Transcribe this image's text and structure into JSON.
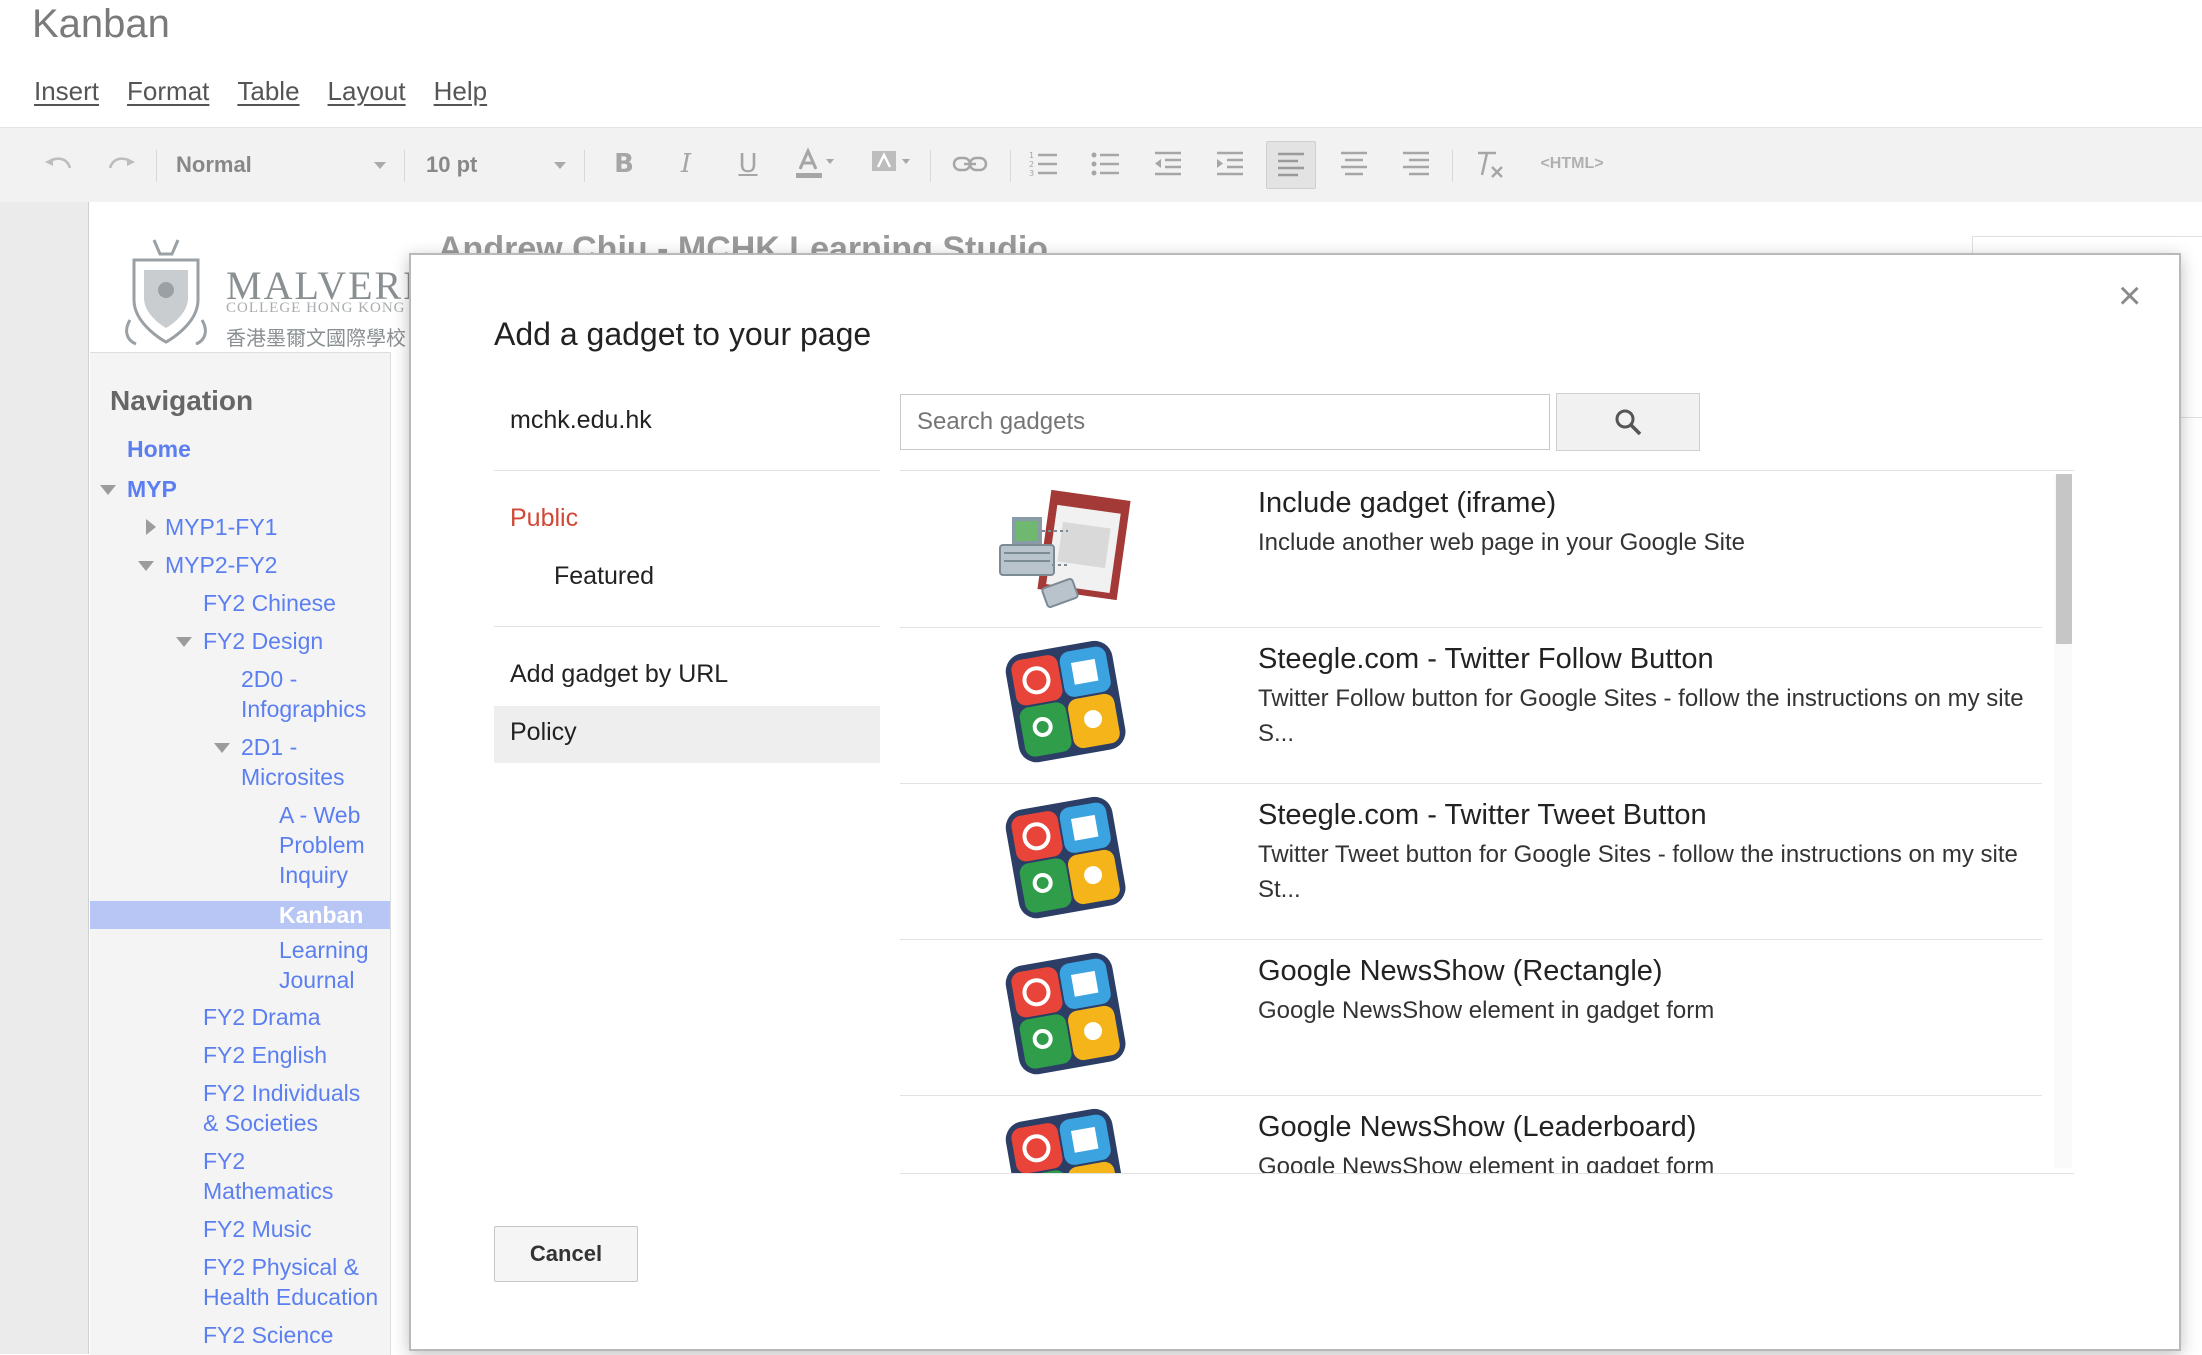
{
  "app": {
    "doc_title": "Kanban"
  },
  "menu": [
    "Insert",
    "Format",
    "Table",
    "Layout",
    "Help"
  ],
  "toolbar": {
    "style_select": "Normal",
    "size_select": "10 pt",
    "html_label": "<HTML>",
    "icons": [
      "undo-icon",
      "redo-icon",
      "bold-icon",
      "italic-icon",
      "underline-icon",
      "text-color-icon",
      "highlight-color-icon",
      "link-icon",
      "numbered-list-icon",
      "bulleted-list-icon",
      "decrease-indent-icon",
      "increase-indent-icon",
      "align-left-icon",
      "align-center-icon",
      "align-right-icon",
      "clear-formatting-icon"
    ]
  },
  "page": {
    "heading": "Andrew Chiu - MCHK Learning Studio",
    "logo": {
      "name": "MALVERN",
      "subtitle": "COLLEGE HONG KONG",
      "chinese": "香港墨爾文國際學校"
    }
  },
  "navigation": {
    "title": "Navigation",
    "items": [
      {
        "label": "Home"
      },
      {
        "label": "MYP"
      },
      {
        "label": "MYP1-FY1"
      },
      {
        "label": "MYP2-FY2"
      },
      {
        "label": "FY2 Chinese"
      },
      {
        "label": "FY2 Design"
      },
      {
        "label": "2D0 -",
        "label2": "Infographics"
      },
      {
        "label": "2D1 -",
        "label2": "Microsites"
      },
      {
        "label": "A - Web",
        "label2": "Problem",
        "label3": "Inquiry"
      },
      {
        "label": "Kanban"
      },
      {
        "label": "Learning",
        "label2": "Journal"
      },
      {
        "label": "FY2 Drama"
      },
      {
        "label": "FY2 English"
      },
      {
        "label": "FY2 Individuals",
        "label2": "& Societies"
      },
      {
        "label": "FY2",
        "label2": "Mathematics"
      },
      {
        "label": "FY2 Music"
      },
      {
        "label": "FY2 Physical &",
        "label2": "Health Education"
      },
      {
        "label": "FY2 Science"
      }
    ]
  },
  "dialog": {
    "title": "Add a gadget to your page",
    "close_glyph": "×",
    "left_menu": {
      "domain": "mchk.edu.hk",
      "public": "Public",
      "featured": "Featured",
      "by_url": "Add gadget by URL",
      "policy": "Policy"
    },
    "search": {
      "placeholder": "Search gadgets"
    },
    "gadgets": [
      {
        "title": "Include gadget (iframe)",
        "description": "Include another web page in your Google Site",
        "icon": "iframe-gadget-icon"
      },
      {
        "title": "Steegle.com - Twitter Follow Button",
        "description": "Twitter Follow button for Google Sites - follow the instructions on my site S...",
        "icon": "gadget-default-icon"
      },
      {
        "title": "Steegle.com - Twitter Tweet Button",
        "description": "Twitter Tweet button for Google Sites - follow the instructions on my site St...",
        "icon": "gadget-default-icon"
      },
      {
        "title": "Google NewsShow (Rectangle)",
        "description": "Google NewsShow element in gadget form",
        "icon": "gadget-default-icon"
      },
      {
        "title": "Google NewsShow (Leaderboard)",
        "description": "Google NewsShow element in gadget form",
        "icon": "gadget-default-icon"
      }
    ],
    "cancel_label": "Cancel"
  },
  "colors": {
    "nav_link": "#5b7ff0",
    "public_red": "#d14836",
    "nav_selected": "#b8c6f5"
  }
}
